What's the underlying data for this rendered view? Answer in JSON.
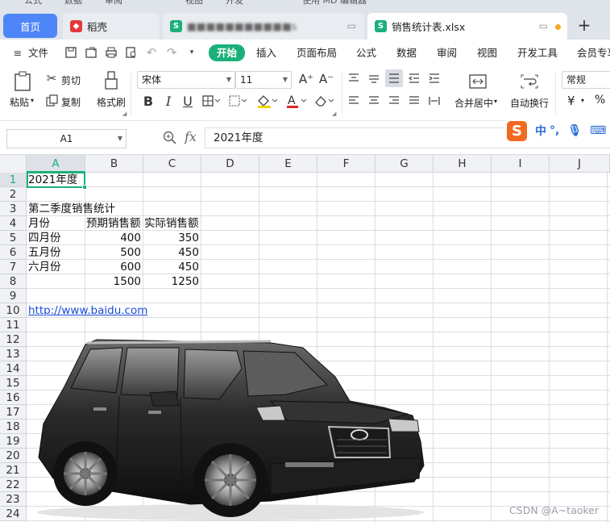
{
  "window": {
    "top_strip_items": [
      "公式",
      "数据",
      "审阅",
      "视图",
      "开发",
      "使用 MD 编辑器"
    ]
  },
  "tabs": {
    "home": "首页",
    "docer": "稻壳",
    "file2_name": "■■■■■■■■■■■s",
    "active_name": "销售统计表.xlsx",
    "add": "+"
  },
  "menu": {
    "file": "文件",
    "start": "开始",
    "insert": "插入",
    "page_layout": "页面布局",
    "formulas": "公式",
    "data": "数据",
    "review": "审阅",
    "view": "视图",
    "developer": "开发工具",
    "member": "会员专享"
  },
  "ribbon": {
    "paste": "粘贴",
    "cut": "剪切",
    "copy": "复制",
    "format_painter": "格式刷",
    "font_name": "宋体",
    "font_size": "11",
    "merge_center": "合并居中",
    "wrap_text": "自动换行",
    "number_format": "常规",
    "currency_symbol": "¥",
    "percent_symbol": "%"
  },
  "formula_bar": {
    "name_box": "A1",
    "fx": "fx",
    "formula": "2021年度"
  },
  "ime": {
    "zh": "中",
    "punct": "°,"
  },
  "sheet": {
    "columns": [
      "A",
      "B",
      "C",
      "D",
      "E",
      "F",
      "G",
      "H",
      "I",
      "J"
    ],
    "rows": [
      "1",
      "2",
      "3",
      "4",
      "5",
      "6",
      "7",
      "8",
      "9",
      "10",
      "11",
      "12",
      "13",
      "14",
      "15",
      "16",
      "17",
      "18",
      "19",
      "20",
      "21",
      "22",
      "23",
      "24"
    ],
    "cells": {
      "A1": "2021年度",
      "A3": "第二季度销售统计",
      "A4": "月份",
      "B4": "预期销售额",
      "C4": "实际销售额",
      "A5": "四月份",
      "B5": "400",
      "C5": "350",
      "A6": "五月份",
      "B6": "500",
      "C6": "450",
      "A7": "六月份",
      "B7": "600",
      "C7": "450",
      "B8": "1500",
      "C8": "1250",
      "A10": "http://www.baidu.com"
    }
  },
  "watermark": "CSDN @A~taoker",
  "colors": {
    "accent": "#1bb07a",
    "home_tab": "#4f86f7",
    "link": "#1a4bd6"
  }
}
